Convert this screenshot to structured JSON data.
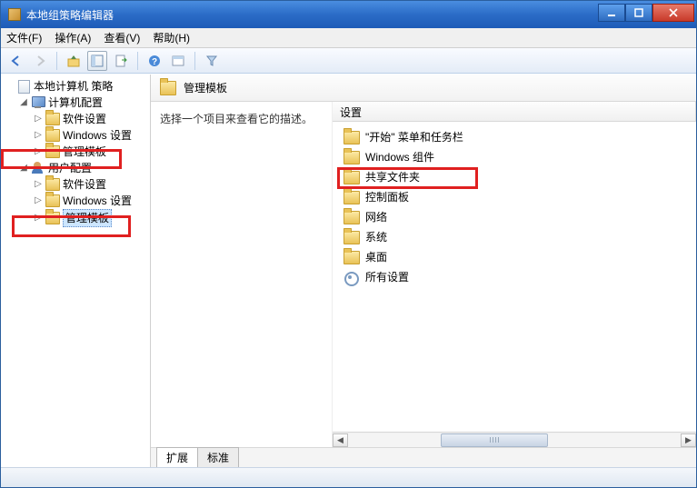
{
  "window": {
    "title": "本地组策略编辑器"
  },
  "menu": {
    "file": "文件(F)",
    "action": "操作(A)",
    "view": "查看(V)",
    "help": "帮助(H)"
  },
  "tree": {
    "root": "本地计算机 策略",
    "computer_config": "计算机配置",
    "cc_software": "软件设置",
    "cc_windows": "Windows 设置",
    "cc_admin": "管理模板",
    "user_config": "用户配置",
    "uc_software": "软件设置",
    "uc_windows": "Windows 设置",
    "uc_admin": "管理模板"
  },
  "content": {
    "header_title": "管理模板",
    "desc_prompt": "选择一个项目来查看它的描述。",
    "col_settings": "设置"
  },
  "items": {
    "start_taskbar": "\"开始\" 菜单和任务栏",
    "windows_components": "Windows 组件",
    "shared_folders": "共享文件夹",
    "control_panel": "控制面板",
    "network": "网络",
    "system": "系统",
    "desktop": "桌面",
    "all_settings": "所有设置"
  },
  "tabs": {
    "extended": "扩展",
    "standard": "标准"
  }
}
